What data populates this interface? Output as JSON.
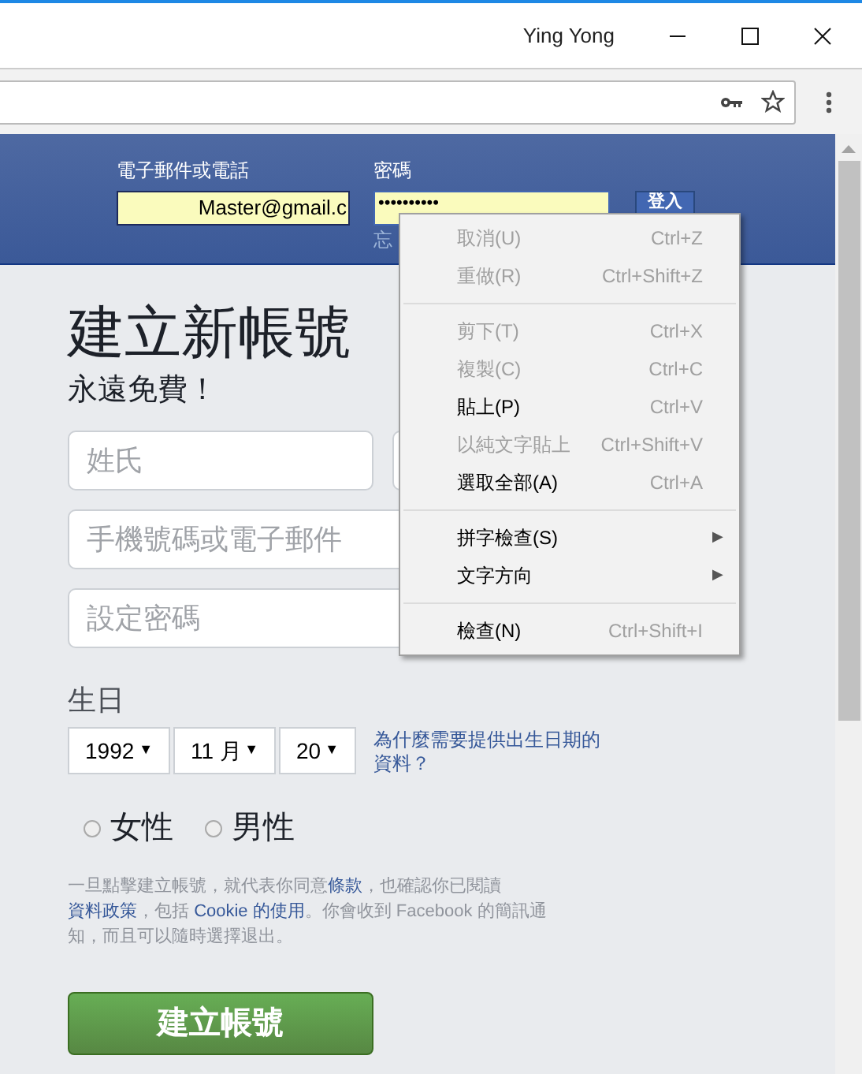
{
  "window": {
    "user": "Ying Yong"
  },
  "header": {
    "email_label": "電子郵件或電話",
    "email_value": "Master@gmail.c",
    "password_label": "密碼",
    "password_value": "••••••••••",
    "login_button": "登入",
    "forgot_link": "忘"
  },
  "signup": {
    "title": "建立新帳號",
    "subtitle": "永遠免費！",
    "fields": [
      {
        "placeholder": "姓氏",
        "kind": "half"
      },
      {
        "kind": "half"
      },
      {
        "placeholder": "手機號碼或電子郵件",
        "kind": "full"
      },
      {
        "placeholder": "設定密碼",
        "kind": "full"
      }
    ],
    "birthday_label": "生日",
    "selects": [
      {
        "value": "1992",
        "caret": "▼"
      },
      {
        "value": "11 月",
        "caret": "▼"
      },
      {
        "value": "20",
        "caret": "▼"
      }
    ],
    "birthday_help": "為什麼需要提供出生日期的資料？",
    "genders": [
      {
        "label": "女性",
        "selected": false
      },
      {
        "label": "男性",
        "selected": false
      }
    ],
    "terms": [
      {
        "text": "一旦點擊建立帳號，就代表你同意",
        "kind": "text"
      },
      {
        "text": "條款",
        "kind": "link"
      },
      {
        "text": "，也確認你已閱讀",
        "kind": "text"
      },
      {
        "text": "資料政策",
        "kind": "link"
      },
      {
        "text": "，包括 ",
        "kind": "text"
      },
      {
        "text": "Cookie 的使用",
        "kind": "link"
      },
      {
        "text": "。你會收到 Facebook 的簡訊通知，而且可以隨時選擇退出。",
        "kind": "text"
      }
    ],
    "submit": "建立帳號"
  },
  "context_menu": [
    {
      "kind": "item",
      "label": "取消(U)",
      "shortcut": "Ctrl+Z",
      "disabled": true
    },
    {
      "kind": "item",
      "label": "重做(R)",
      "shortcut": "Ctrl+Shift+Z",
      "disabled": true
    },
    {
      "kind": "separator"
    },
    {
      "kind": "item",
      "label": "剪下(T)",
      "shortcut": "Ctrl+X",
      "disabled": true
    },
    {
      "kind": "item",
      "label": "複製(C)",
      "shortcut": "Ctrl+C",
      "disabled": true
    },
    {
      "kind": "item",
      "label": "貼上(P)",
      "shortcut": "Ctrl+V",
      "disabled": false
    },
    {
      "kind": "item",
      "label": "以純文字貼上",
      "shortcut": "Ctrl+Shift+V",
      "disabled": true
    },
    {
      "kind": "item",
      "label": "選取全部(A)",
      "shortcut": "Ctrl+A",
      "disabled": false
    },
    {
      "kind": "separator"
    },
    {
      "kind": "submenu",
      "label": "拼字檢查(S)",
      "arrow": "▶",
      "disabled": false
    },
    {
      "kind": "submenu",
      "label": "文字方向",
      "arrow": "▶",
      "disabled": false
    },
    {
      "kind": "separator"
    },
    {
      "kind": "item",
      "label": "檢查(N)",
      "shortcut": "Ctrl+Shift+I",
      "disabled": false
    }
  ]
}
